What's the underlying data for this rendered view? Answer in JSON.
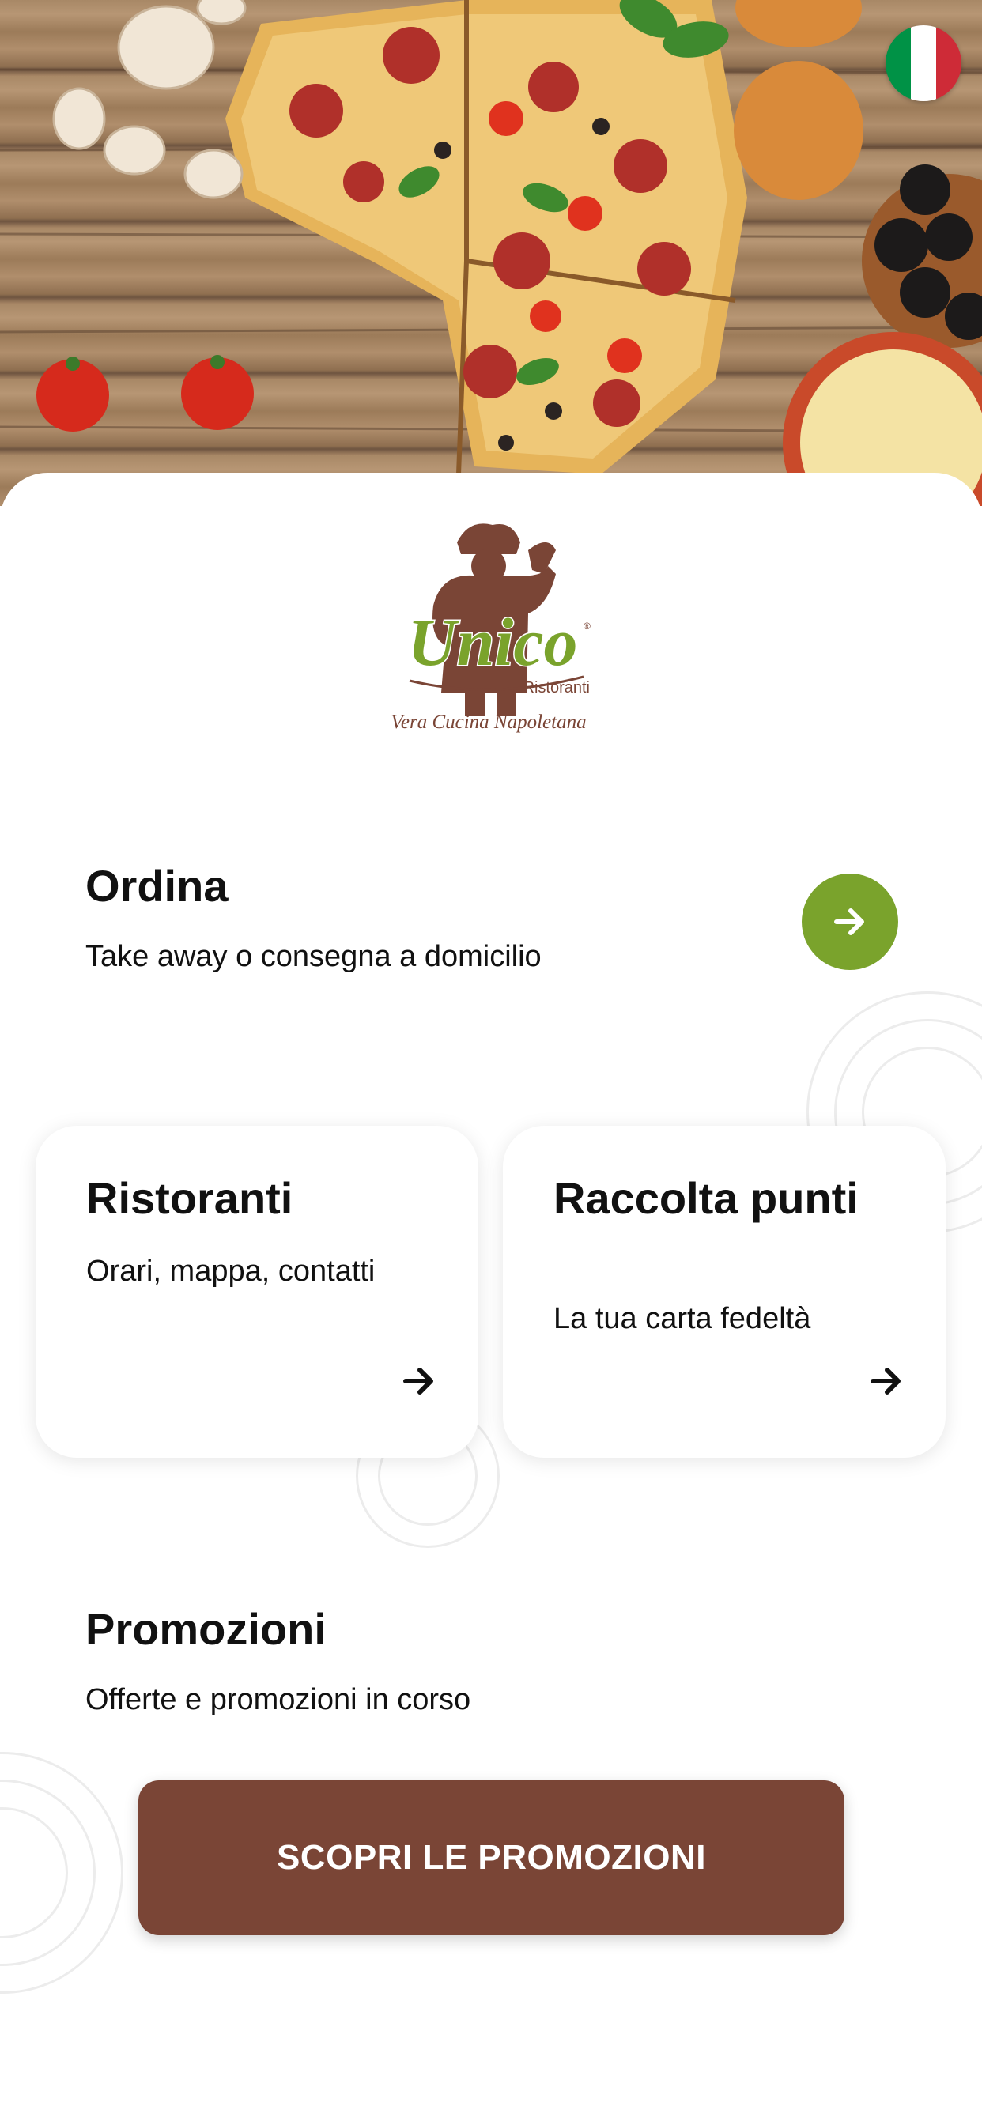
{
  "hero": {
    "image_name": "pizza-on-wooden-table"
  },
  "language": {
    "flag_name": "italy-flag",
    "colors": [
      "#009246",
      "#ffffff",
      "#ce2b37"
    ]
  },
  "brand": {
    "logo_name": "unico-ristoranti-logo",
    "logo_text": "Unico",
    "logo_subtext": "Ristoranti",
    "tagline": "Vera Cucina Napoletana",
    "colors": {
      "brown": "#7a4536",
      "green": "#7aa32c"
    }
  },
  "ordina": {
    "title": "Ordina",
    "subtitle": "Take away o consegna a domicilio",
    "button_icon": "arrow-right-icon"
  },
  "cards": [
    {
      "title": "Ristoranti",
      "subtitle": "Orari, mappa, contatti",
      "icon": "arrow-right-icon"
    },
    {
      "title": "Raccolta punti",
      "subtitle": "La tua carta fedeltà",
      "icon": "arrow-right-icon"
    }
  ],
  "promozioni": {
    "title": "Promozioni",
    "subtitle": "Offerte e promozioni in corso",
    "button_label": "SCOPRI LE PROMOZIONI"
  }
}
